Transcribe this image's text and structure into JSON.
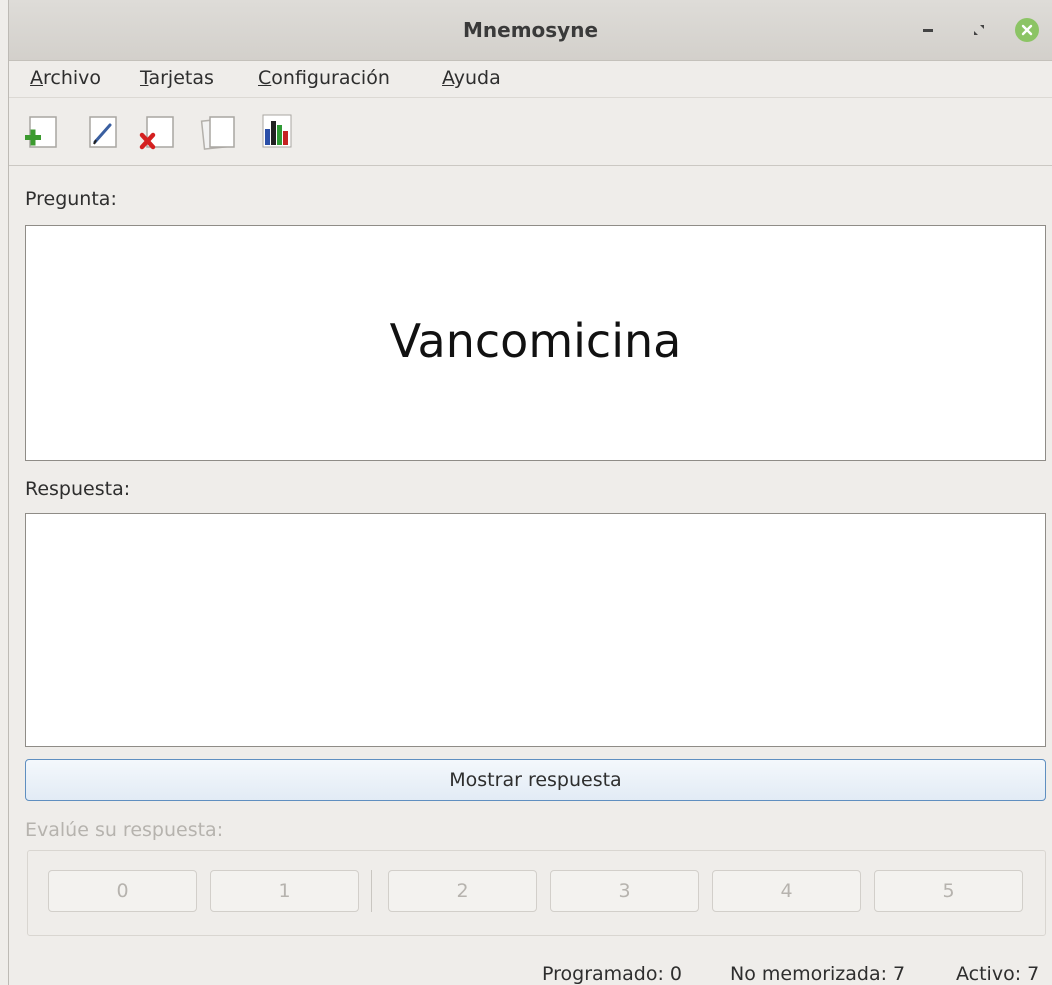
{
  "window": {
    "title": "Mnemosyne"
  },
  "menu": {
    "items": [
      {
        "label": "Archivo"
      },
      {
        "label": "Tarjetas"
      },
      {
        "label": "Configuración"
      },
      {
        "label": "Ayuda"
      }
    ]
  },
  "toolbar": {
    "icons": [
      "add-card-icon",
      "edit-card-icon",
      "delete-card-icon",
      "card-browser-icon",
      "statistics-icon"
    ]
  },
  "question": {
    "label": "Pregunta:",
    "text": "Vancomicina"
  },
  "answer": {
    "label": "Respuesta:",
    "text": ""
  },
  "show_answer_button": "Mostrar respuesta",
  "grading": {
    "label": "Evalúe su respuesta:",
    "grades": [
      "0",
      "1",
      "2",
      "3",
      "4",
      "5"
    ]
  },
  "status": {
    "scheduled": "Programado: 0",
    "not_memorised": "No memorizada: 7",
    "active": "Activo: 7"
  },
  "colors": {
    "titlebar": "#d8d6d2",
    "close_button": "#8cc465",
    "background": "#efedea",
    "show_button_border": "#5f8fc0"
  }
}
